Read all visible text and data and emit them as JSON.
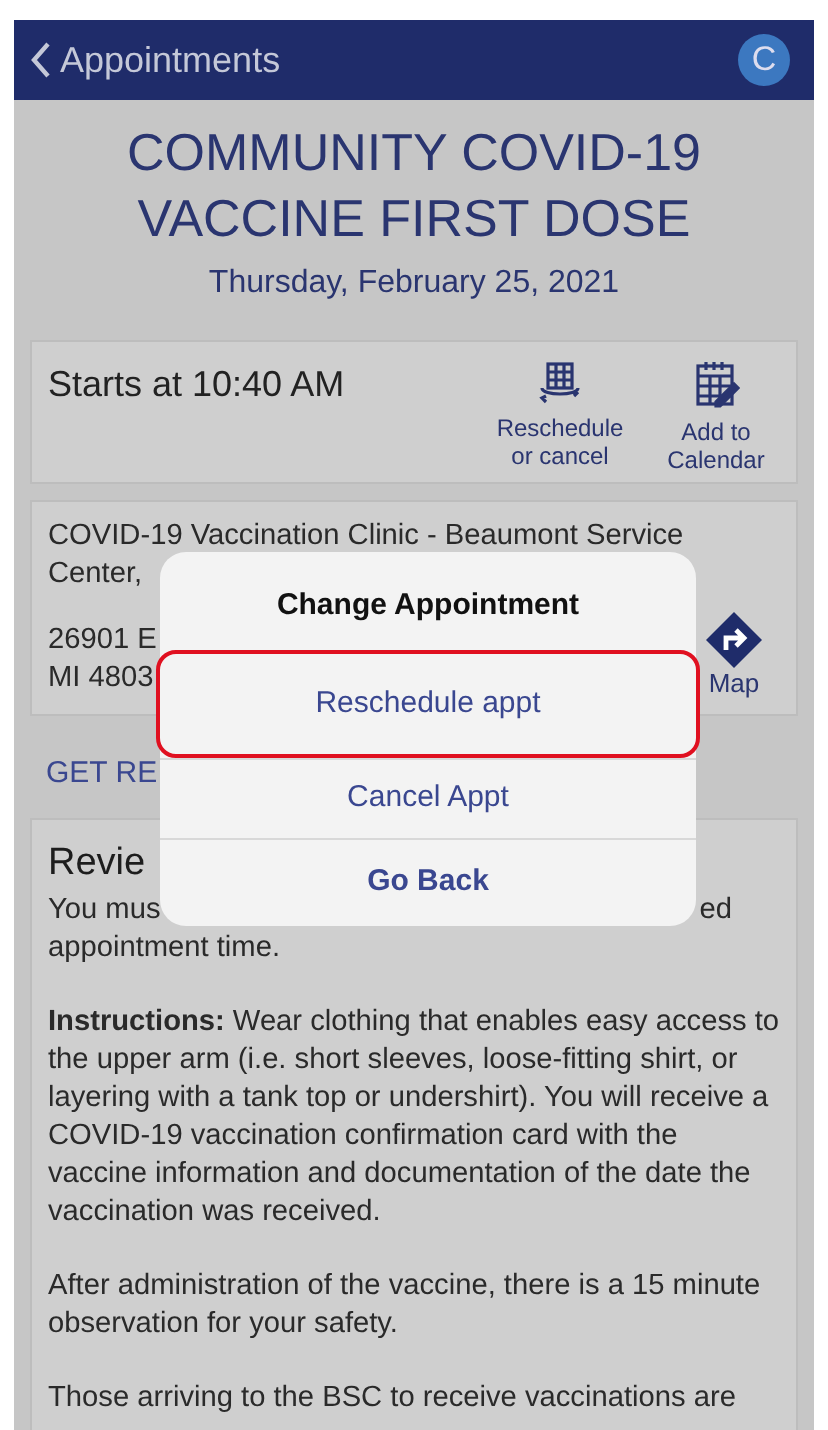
{
  "nav": {
    "back_label": "Appointments",
    "avatar": "C"
  },
  "title": "COMMUNITY COVID-19 VACCINE FIRST DOSE",
  "date": "Thursday, February 25, 2021",
  "time_card": {
    "start": "Starts at 10:40 AM",
    "actions": [
      {
        "label": "Reschedule or cancel",
        "kind": "reschedule"
      },
      {
        "label": "Add to Calendar",
        "kind": "calendar"
      }
    ]
  },
  "location_card": {
    "name_lines": [
      "COVID-19 Vaccination Clinic - Beaumont Service",
      "Center,"
    ],
    "address_lines": [
      "26901 E",
      "MI 4803"
    ],
    "map_label": "Map"
  },
  "section_heading": "GET RE",
  "review_card": {
    "heading": "Revie",
    "intro_left": "You mus",
    "intro_right": "ed",
    "intro_end": "appointment time.",
    "paragraphs": [
      "**Instructions:** Wear clothing that enables easy access to the upper arm (i.e. short sleeves, loose-fitting shirt, or layering with a tank top or undershirt). You will receive a COVID-19 vaccination confirmation card with the vaccine information and documentation of the date the vaccination was received.",
      "After administration of the vaccine, there is a 15 minute observation for your safety.",
      "Those arriving to the BSC to receive vaccinations are"
    ]
  },
  "dialog": {
    "title": "Change Appointment",
    "options": [
      {
        "label": "Reschedule appt",
        "kind": "action",
        "highlighted": true
      },
      {
        "label": "Cancel Appt",
        "kind": "action",
        "highlighted": false
      },
      {
        "label": "Go Back",
        "kind": "cancel",
        "highlighted": false
      }
    ]
  }
}
